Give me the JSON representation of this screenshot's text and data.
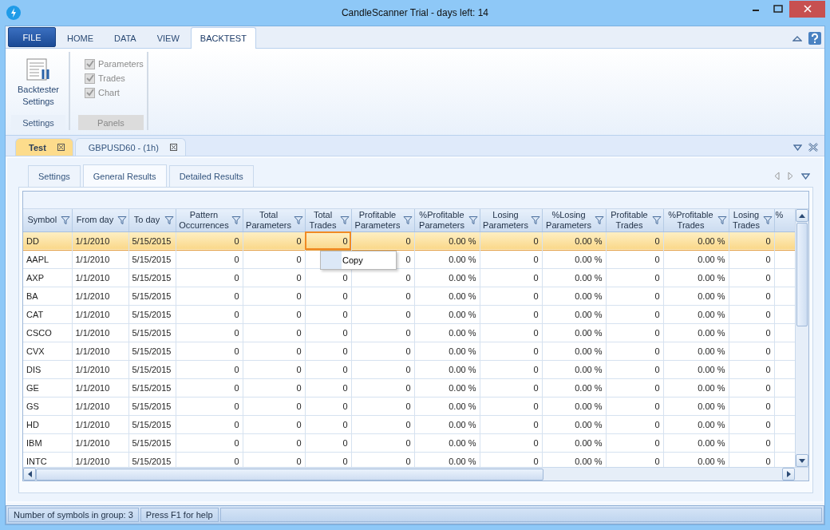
{
  "window": {
    "title": "CandleScanner Trial  - days left: 14"
  },
  "ribbon": {
    "tabs": [
      {
        "label": "FILE",
        "kind": "file"
      },
      {
        "label": "HOME",
        "kind": "tab",
        "selected": false
      },
      {
        "label": "DATA",
        "kind": "tab",
        "selected": false
      },
      {
        "label": "VIEW",
        "kind": "tab",
        "selected": false
      },
      {
        "label": "BACKTEST",
        "kind": "tab",
        "selected": true
      }
    ],
    "groups": [
      {
        "name": "Settings",
        "kind": "buttons",
        "buttons": [
          {
            "label": "Backtester Settings"
          }
        ]
      },
      {
        "name": "Panels",
        "kind": "checks",
        "disabled": true,
        "items": [
          {
            "label": "Parameters",
            "checked": true
          },
          {
            "label": "Trades",
            "checked": true
          },
          {
            "label": "Chart",
            "checked": true
          }
        ]
      }
    ]
  },
  "documents": [
    {
      "label": "Test",
      "selected": true
    },
    {
      "label": "GBPUSD60 - (1h)",
      "selected": false
    }
  ],
  "result_tabs": [
    {
      "label": "Settings",
      "selected": false
    },
    {
      "label": "General Results",
      "selected": true
    },
    {
      "label": "Detailed Results",
      "selected": false
    }
  ],
  "table": {
    "columns": [
      "Symbol",
      "From day",
      "To day",
      "Pattern Occurrences",
      "Total Parameters",
      "Total Trades",
      "Profitable Parameters",
      "%Profitable Parameters",
      "Losing Parameters",
      "%Losing Parameters",
      "Profitable Trades",
      "%Profitable Trades",
      "Losing Trades",
      "%"
    ],
    "rows": [
      {
        "selected": true,
        "cells": [
          "DD",
          "1/1/2010",
          "5/15/2015",
          "0",
          "0",
          "0",
          "0",
          "0.00 %",
          "0",
          "0.00 %",
          "0",
          "0.00 %",
          "0"
        ]
      },
      {
        "selected": false,
        "cells": [
          "AAPL",
          "1/1/2010",
          "5/15/2015",
          "0",
          "0",
          null,
          "0",
          "0.00 %",
          "0",
          "0.00 %",
          "0",
          "0.00 %",
          "0"
        ]
      },
      {
        "selected": false,
        "cells": [
          "AXP",
          "1/1/2010",
          "5/15/2015",
          "0",
          "0",
          "0",
          "0",
          "0.00 %",
          "0",
          "0.00 %",
          "0",
          "0.00 %",
          "0"
        ]
      },
      {
        "selected": false,
        "cells": [
          "BA",
          "1/1/2010",
          "5/15/2015",
          "0",
          "0",
          "0",
          "0",
          "0.00 %",
          "0",
          "0.00 %",
          "0",
          "0.00 %",
          "0"
        ]
      },
      {
        "selected": false,
        "cells": [
          "CAT",
          "1/1/2010",
          "5/15/2015",
          "0",
          "0",
          "0",
          "0",
          "0.00 %",
          "0",
          "0.00 %",
          "0",
          "0.00 %",
          "0"
        ]
      },
      {
        "selected": false,
        "cells": [
          "CSCO",
          "1/1/2010",
          "5/15/2015",
          "0",
          "0",
          "0",
          "0",
          "0.00 %",
          "0",
          "0.00 %",
          "0",
          "0.00 %",
          "0"
        ]
      },
      {
        "selected": false,
        "cells": [
          "CVX",
          "1/1/2010",
          "5/15/2015",
          "0",
          "0",
          "0",
          "0",
          "0.00 %",
          "0",
          "0.00 %",
          "0",
          "0.00 %",
          "0"
        ]
      },
      {
        "selected": false,
        "cells": [
          "DIS",
          "1/1/2010",
          "5/15/2015",
          "0",
          "0",
          "0",
          "0",
          "0.00 %",
          "0",
          "0.00 %",
          "0",
          "0.00 %",
          "0"
        ]
      },
      {
        "selected": false,
        "cells": [
          "GE",
          "1/1/2010",
          "5/15/2015",
          "0",
          "0",
          "0",
          "0",
          "0.00 %",
          "0",
          "0.00 %",
          "0",
          "0.00 %",
          "0"
        ]
      },
      {
        "selected": false,
        "cells": [
          "GS",
          "1/1/2010",
          "5/15/2015",
          "0",
          "0",
          "0",
          "0",
          "0.00 %",
          "0",
          "0.00 %",
          "0",
          "0.00 %",
          "0"
        ]
      },
      {
        "selected": false,
        "cells": [
          "HD",
          "1/1/2010",
          "5/15/2015",
          "0",
          "0",
          "0",
          "0",
          "0.00 %",
          "0",
          "0.00 %",
          "0",
          "0.00 %",
          "0"
        ]
      },
      {
        "selected": false,
        "cells": [
          "IBM",
          "1/1/2010",
          "5/15/2015",
          "0",
          "0",
          "0",
          "0",
          "0.00 %",
          "0",
          "0.00 %",
          "0",
          "0.00 %",
          "0"
        ]
      },
      {
        "selected": false,
        "cells": [
          "INTC",
          "1/1/2010",
          "5/15/2015",
          "0",
          "0",
          "0",
          "0",
          "0.00 %",
          "0",
          "0.00 %",
          "0",
          "0.00 %",
          "0"
        ]
      }
    ]
  },
  "context_menu": {
    "items": [
      "Copy"
    ]
  },
  "status_bar": [
    "Number of symbols in group: 3",
    "Press F1 for help"
  ]
}
